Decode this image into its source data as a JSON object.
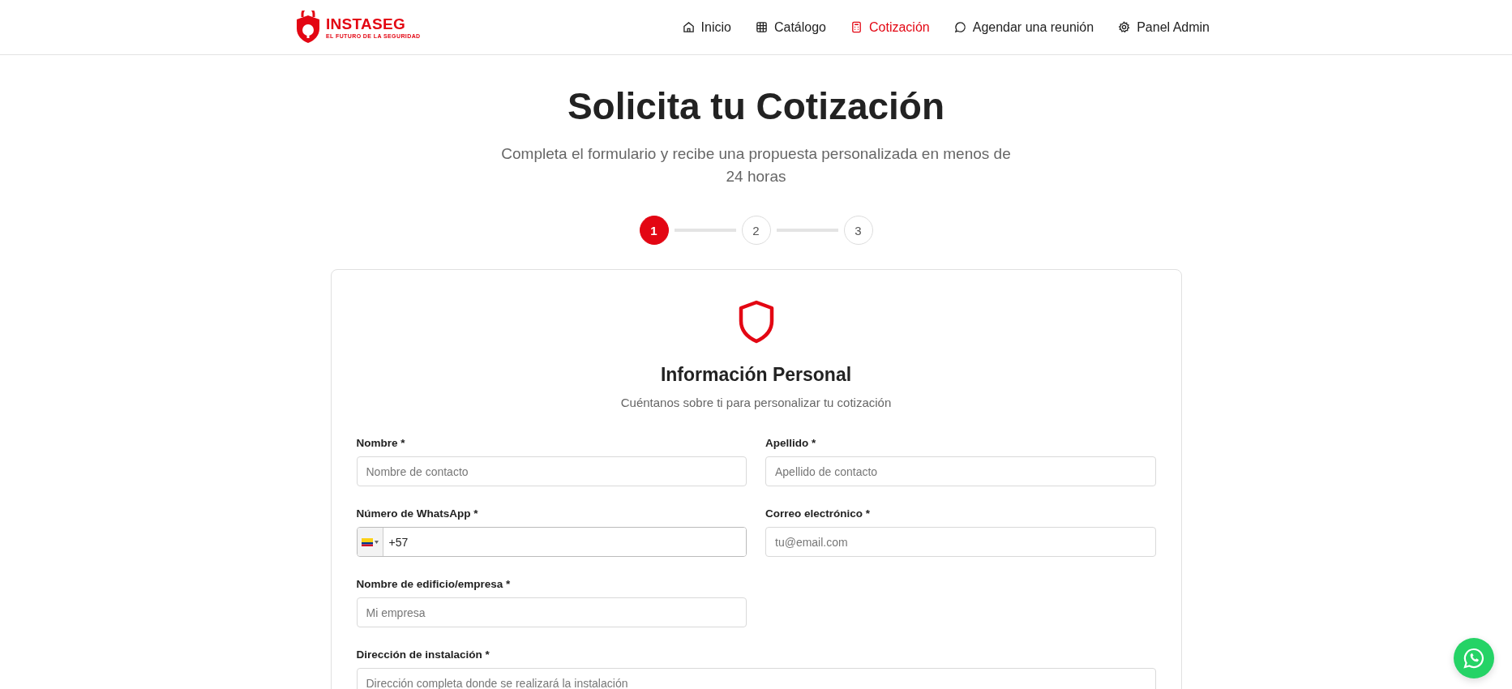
{
  "header": {
    "logo": {
      "name": "INSTASEG",
      "tagline": "EL FUTURO DE LA SEGURIDAD"
    },
    "nav": [
      {
        "label": "Inicio",
        "selected": false
      },
      {
        "label": "Catálogo",
        "selected": false
      },
      {
        "label": "Cotización",
        "selected": true
      },
      {
        "label": "Agendar una reunión",
        "selected": false
      },
      {
        "label": "Panel Admin",
        "selected": false
      }
    ]
  },
  "hero": {
    "title": "Solicita tu Cotización",
    "subtitle": "Completa el formulario y recibe una propuesta personalizada en menos de 24 horas"
  },
  "steps": [
    {
      "label": "1",
      "selected": true
    },
    {
      "label": "2",
      "selected": false
    },
    {
      "label": "3",
      "selected": false
    }
  ],
  "form": {
    "title": "Información Personal",
    "subtitle": "Cuéntanos sobre ti para personalizar tu cotización",
    "fields": [
      {
        "kind": "text",
        "label": "Nombre *",
        "placeholder": "Nombre de contacto"
      },
      {
        "kind": "text",
        "label": "Apellido *",
        "placeholder": "Apellido de contacto"
      },
      {
        "kind": "phone",
        "label": "Número de WhatsApp *",
        "value": "+57"
      },
      {
        "kind": "text",
        "label": "Correo electrónico *",
        "placeholder": "tu@email.com"
      },
      {
        "kind": "text",
        "label": "Nombre de edificio/empresa *",
        "placeholder": "Mi empresa"
      },
      {
        "kind": "wide",
        "label": "Dirección de instalación *",
        "placeholder": "Dirección completa donde se realizará la instalación"
      }
    ]
  }
}
